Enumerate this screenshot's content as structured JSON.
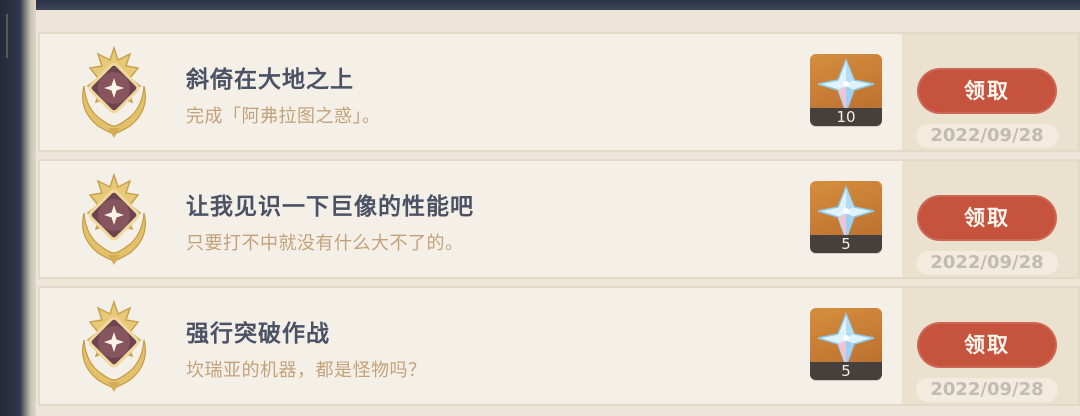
{
  "achievements": [
    {
      "title": "斜倚在大地之上",
      "description": "完成「阿弗拉图之惑」。",
      "reward_count": "10",
      "claim_label": "领取",
      "date": "2022/09/28"
    },
    {
      "title": "让我见识一下巨像的性能吧",
      "description": "只要打不中就没有什么大不了的。",
      "reward_count": "5",
      "claim_label": "领取",
      "date": "2022/09/28"
    },
    {
      "title": "强行突破作战",
      "description": "坎瑞亚的机器，都是怪物吗？",
      "reward_count": "5",
      "claim_label": "领取",
      "date": "2022/09/28"
    }
  ],
  "icons": {
    "badge": "achievement-laurel-badge-icon",
    "reward": "primogem-icon"
  },
  "colors": {
    "claim_button": "#c5533e",
    "title_text": "#4a5264",
    "description_text": "#c3a27a",
    "reward_background": "#d58e3e"
  }
}
